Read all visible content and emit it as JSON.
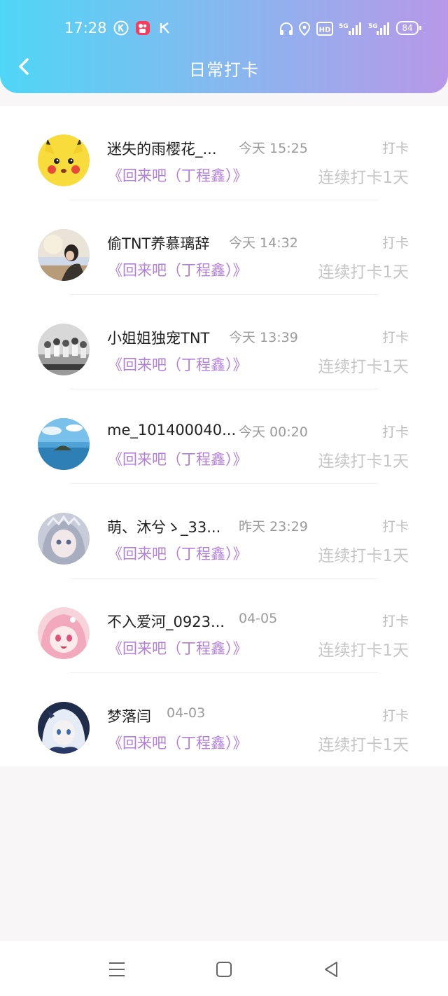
{
  "status": {
    "time": "17:28",
    "battery": "84",
    "network1": "5G",
    "network2": "5G",
    "hd": "HD"
  },
  "header": {
    "title": "日常打卡"
  },
  "items": [
    {
      "name": "迷失的雨樱花_...",
      "time": "今天 15:25",
      "book": "《回来吧（丁程鑫）》",
      "action": "打卡",
      "streak": "连续打卡1天"
    },
    {
      "name": "偷TNT养慕璃辞",
      "time": "今天 14:32",
      "book": "《回来吧（丁程鑫）》",
      "action": "打卡",
      "streak": "连续打卡1天"
    },
    {
      "name": "小姐姐独宠TNT",
      "time": "今天 13:39",
      "book": "《回来吧（丁程鑫）》",
      "action": "打卡",
      "streak": "连续打卡1天"
    },
    {
      "name": "me_101400040...",
      "time": "今天 00:20",
      "book": "《回来吧（丁程鑫）》",
      "action": "打卡",
      "streak": "连续打卡1天"
    },
    {
      "name": "萌、沐兮ゝ_33...",
      "time": "昨天 23:29",
      "book": "《回来吧（丁程鑫）》",
      "action": "打卡",
      "streak": "连续打卡1天"
    },
    {
      "name": "不入爱河_0923...",
      "time": "04-05",
      "book": "《回来吧（丁程鑫）》",
      "action": "打卡",
      "streak": "连续打卡1天"
    },
    {
      "name": "梦落闫",
      "time": "04-03",
      "book": "《回来吧（丁程鑫）》",
      "action": "打卡",
      "streak": "连续打卡1天"
    }
  ],
  "colors": {
    "header_gradient_start": "#4fd6f6",
    "header_gradient_end": "#b898e8",
    "book_title": "#b27fd9",
    "muted": "#c6c6c6"
  }
}
